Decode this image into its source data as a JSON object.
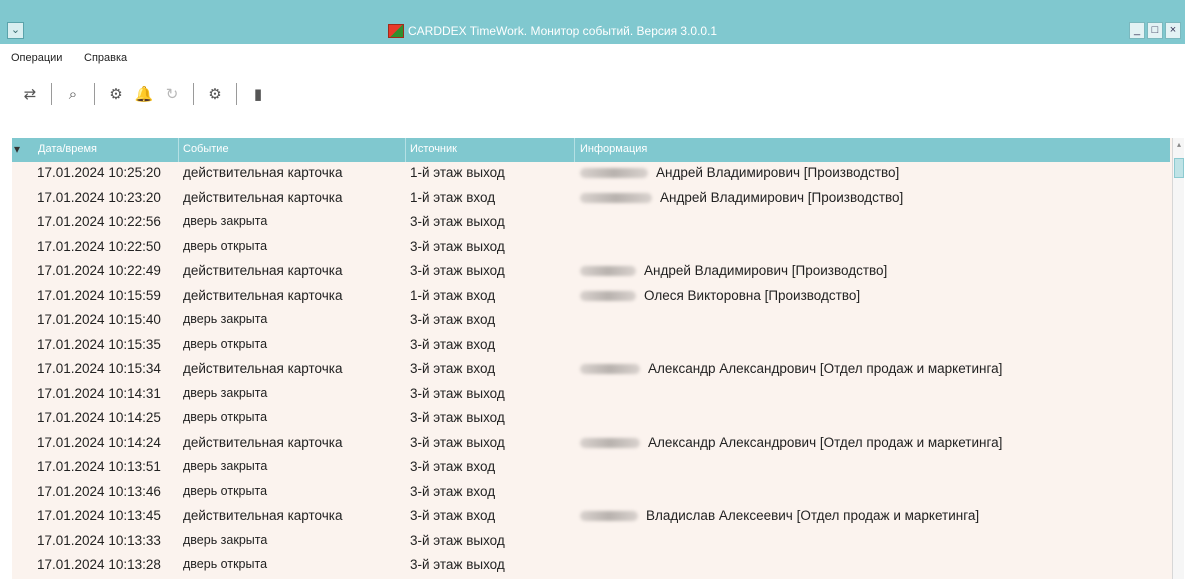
{
  "window": {
    "title": "CARDDEX TimeWork. Монитор событий. Версия 3.0.0.1",
    "sysmenu_glyph": "⌄",
    "buttons": {
      "minimize": "_",
      "maximize": "□",
      "close": "×"
    }
  },
  "menu": {
    "items": [
      {
        "label": "Операции"
      },
      {
        "label": "Справка"
      }
    ]
  },
  "toolbar": {
    "buttons": [
      {
        "icon": "swap-arrows-icon",
        "glyph": "⇄"
      },
      {
        "icon": "search-icon",
        "glyph": "⌕"
      },
      {
        "icon": "gear-icon",
        "glyph": "⚙"
      },
      {
        "icon": "bell-icon",
        "glyph": "🔔"
      },
      {
        "icon": "refresh-icon",
        "glyph": "↻"
      },
      {
        "icon": "settings-icon",
        "glyph": "⚙"
      },
      {
        "icon": "exit-door-icon",
        "glyph": "▮"
      }
    ]
  },
  "table": {
    "columns": [
      "Дата/время",
      "Событие",
      "Источник",
      "Информация"
    ],
    "rows": [
      {
        "datetime": "17.01.2024 10:25:20",
        "event": "действительная карточка",
        "source": "1-й этаж выход",
        "info": "Андрей Владимирович [Производство]"
      },
      {
        "datetime": "17.01.2024 10:23:20",
        "event": "действительная карточка",
        "source": "1-й этаж вход",
        "info": "Андрей Владимирович [Производство]"
      },
      {
        "datetime": "17.01.2024 10:22:56",
        "event": "дверь закрыта",
        "source": "3-й этаж выход",
        "info": ""
      },
      {
        "datetime": "17.01.2024 10:22:50",
        "event": "дверь открыта",
        "source": "3-й этаж выход",
        "info": ""
      },
      {
        "datetime": "17.01.2024 10:22:49",
        "event": "действительная карточка",
        "source": "3-й этаж выход",
        "info": "Андрей Владимирович [Производство]"
      },
      {
        "datetime": "17.01.2024 10:15:59",
        "event": "действительная карточка",
        "source": "1-й этаж вход",
        "info": "Олеся Викторовна [Производство]"
      },
      {
        "datetime": "17.01.2024 10:15:40",
        "event": "дверь закрыта",
        "source": "3-й этаж вход",
        "info": ""
      },
      {
        "datetime": "17.01.2024 10:15:35",
        "event": "дверь открыта",
        "source": "3-й этаж вход",
        "info": ""
      },
      {
        "datetime": "17.01.2024 10:15:34",
        "event": "действительная карточка",
        "source": "3-й этаж вход",
        "info": "Александр Александрович [Отдел продаж и маркетинга]"
      },
      {
        "datetime": "17.01.2024 10:14:31",
        "event": "дверь закрыта",
        "source": "3-й этаж выход",
        "info": ""
      },
      {
        "datetime": "17.01.2024 10:14:25",
        "event": "дверь открыта",
        "source": "3-й этаж выход",
        "info": ""
      },
      {
        "datetime": "17.01.2024 10:14:24",
        "event": "действительная карточка",
        "source": "3-й этаж выход",
        "info": "Александр Александрович [Отдел продаж и маркетинга]"
      },
      {
        "datetime": "17.01.2024 10:13:51",
        "event": "дверь закрыта",
        "source": "3-й этаж вход",
        "info": ""
      },
      {
        "datetime": "17.01.2024 10:13:46",
        "event": "дверь открыта",
        "source": "3-й этаж вход",
        "info": ""
      },
      {
        "datetime": "17.01.2024 10:13:45",
        "event": "действительная карточка",
        "source": "3-й этаж вход",
        "info": "Владислав Алексеевич [Отдел продаж и маркетинга]"
      },
      {
        "datetime": "17.01.2024 10:13:33",
        "event": "дверь закрыта",
        "source": "3-й этаж выход",
        "info": ""
      },
      {
        "datetime": "17.01.2024 10:13:28",
        "event": "дверь открыта",
        "source": "3-й этаж выход",
        "info": ""
      }
    ]
  },
  "colors": {
    "accent": "#80c8cf",
    "grid_background": "#fbf3ee"
  }
}
